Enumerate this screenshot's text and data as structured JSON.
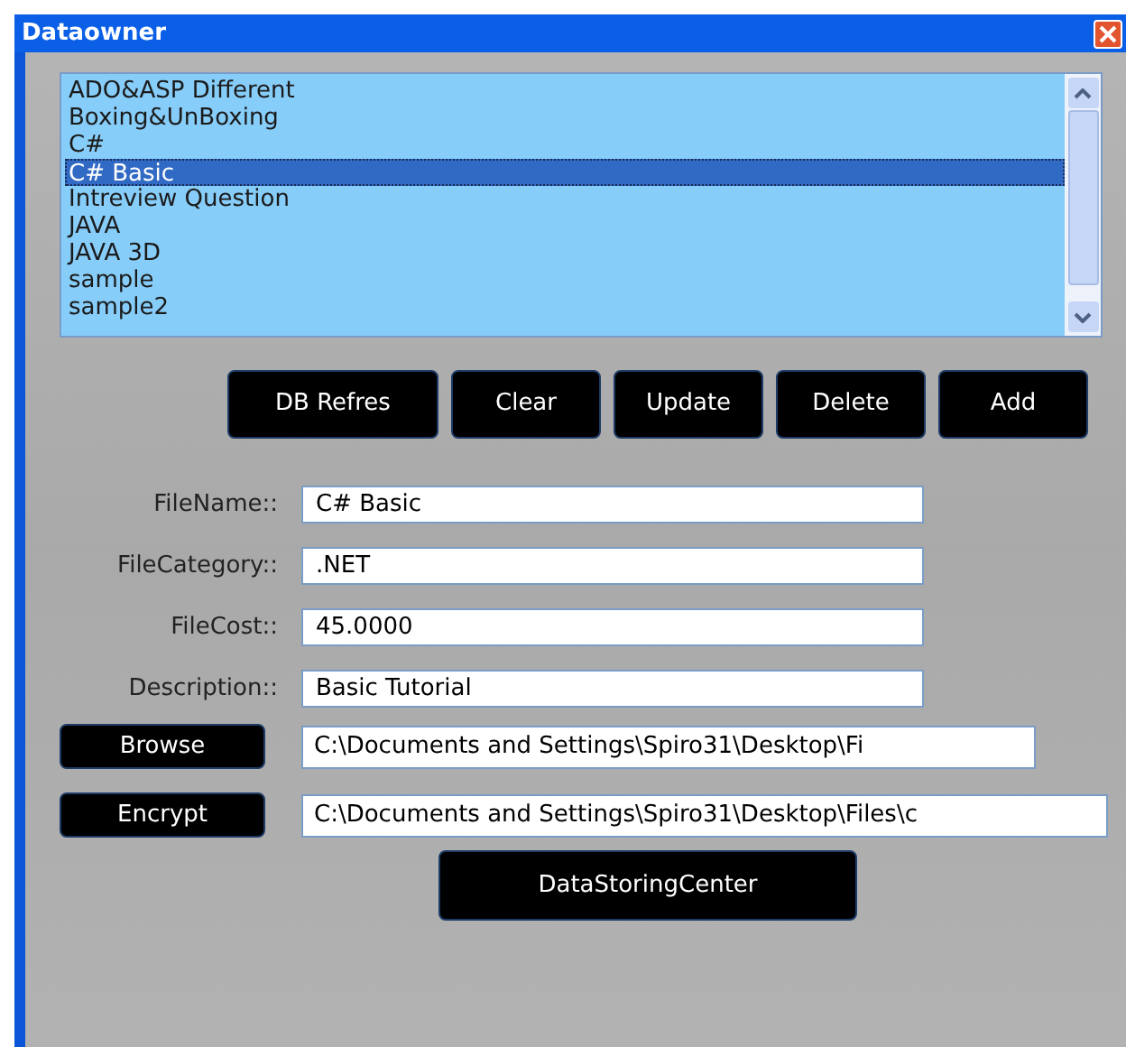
{
  "window": {
    "title": "Dataowner"
  },
  "list": {
    "items": [
      {
        "label": "ADO&ASP Different",
        "selected": false
      },
      {
        "label": "Boxing&UnBoxing",
        "selected": false
      },
      {
        "label": "C#",
        "selected": false
      },
      {
        "label": "C# Basic",
        "selected": true
      },
      {
        "label": "Intreview Question",
        "selected": false
      },
      {
        "label": "JAVA",
        "selected": false
      },
      {
        "label": "JAVA 3D",
        "selected": false
      },
      {
        "label": "sample",
        "selected": false
      },
      {
        "label": "sample2",
        "selected": false
      }
    ]
  },
  "toolbar": [
    "DB Refres",
    "Clear",
    "Update",
    "Delete",
    "Add"
  ],
  "form": [
    {
      "label": "FileName::",
      "value": "C# Basic"
    },
    {
      "label": "FileCategory::",
      "value": ".NET"
    },
    {
      "label": "FileCost::",
      "value": "45.0000"
    },
    {
      "label": "Description::",
      "value": "Basic Tutorial"
    }
  ],
  "paths": [
    {
      "button": "Browse",
      "value": "C:\\Documents and Settings\\Spiro31\\Desktop\\Fi"
    },
    {
      "button": "Encrypt",
      "value": "C:\\Documents and Settings\\Spiro31\\Desktop\\Files\\c"
    }
  ],
  "action": "DataStoringCenter"
}
